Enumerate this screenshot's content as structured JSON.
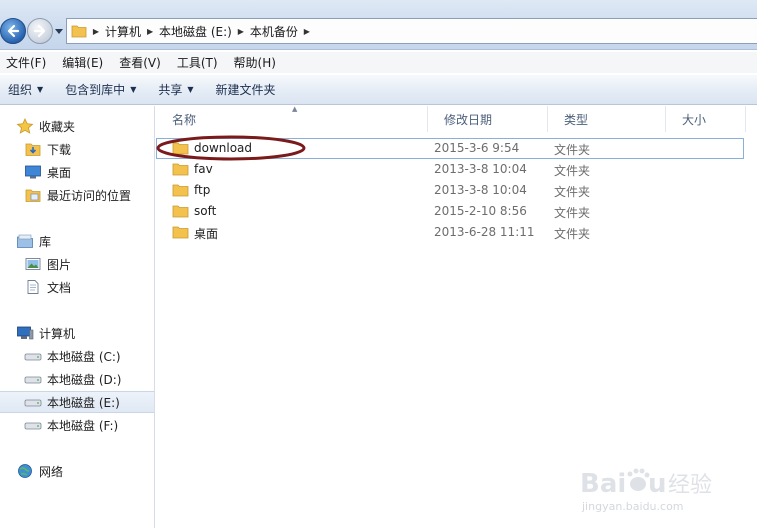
{
  "address": {
    "crumbs": [
      "计算机",
      "本地磁盘 (E:)",
      "本机备份"
    ]
  },
  "menu": [
    "文件(F)",
    "编辑(E)",
    "查看(V)",
    "工具(T)",
    "帮助(H)"
  ],
  "commands": [
    {
      "label": "组织",
      "dropdown": true
    },
    {
      "label": "包含到库中",
      "dropdown": true
    },
    {
      "label": "共享",
      "dropdown": true
    },
    {
      "label": "新建文件夹",
      "dropdown": false
    }
  ],
  "nav": {
    "favorites": {
      "label": "收藏夹",
      "items": [
        "下载",
        "桌面",
        "最近访问的位置"
      ]
    },
    "libraries": {
      "label": "库",
      "items": [
        "图片",
        "文档"
      ]
    },
    "computer": {
      "label": "计算机",
      "items": [
        "本地磁盘 (C:)",
        "本地磁盘 (D:)",
        "本地磁盘 (E:)",
        "本地磁盘 (F:)"
      ],
      "selected": "本地磁盘 (E:)"
    },
    "network": {
      "label": "网络"
    }
  },
  "columns": {
    "name": "名称",
    "modified": "修改日期",
    "type": "类型",
    "size": "大小"
  },
  "files": [
    {
      "name": "download",
      "modified": "2015-3-6  9:54",
      "type": "文件夹",
      "focused": true
    },
    {
      "name": "fav",
      "modified": "2013-3-8  10:04",
      "type": "文件夹"
    },
    {
      "name": "ftp",
      "modified": "2013-3-8  10:04",
      "type": "文件夹"
    },
    {
      "name": "soft",
      "modified": "2015-2-10  8:56",
      "type": "文件夹"
    },
    {
      "name": "桌面",
      "modified": "2013-6-28  11:11",
      "type": "文件夹"
    }
  ],
  "annotation": {
    "color": "#7a1a1a"
  },
  "watermark": {
    "brand": "Baidu",
    "product": "经验",
    "url": "jingyan.baidu.com"
  },
  "colors": {
    "folder": "#f2c14e",
    "selection": "#dfe8f4",
    "accent": "#2864b0"
  }
}
